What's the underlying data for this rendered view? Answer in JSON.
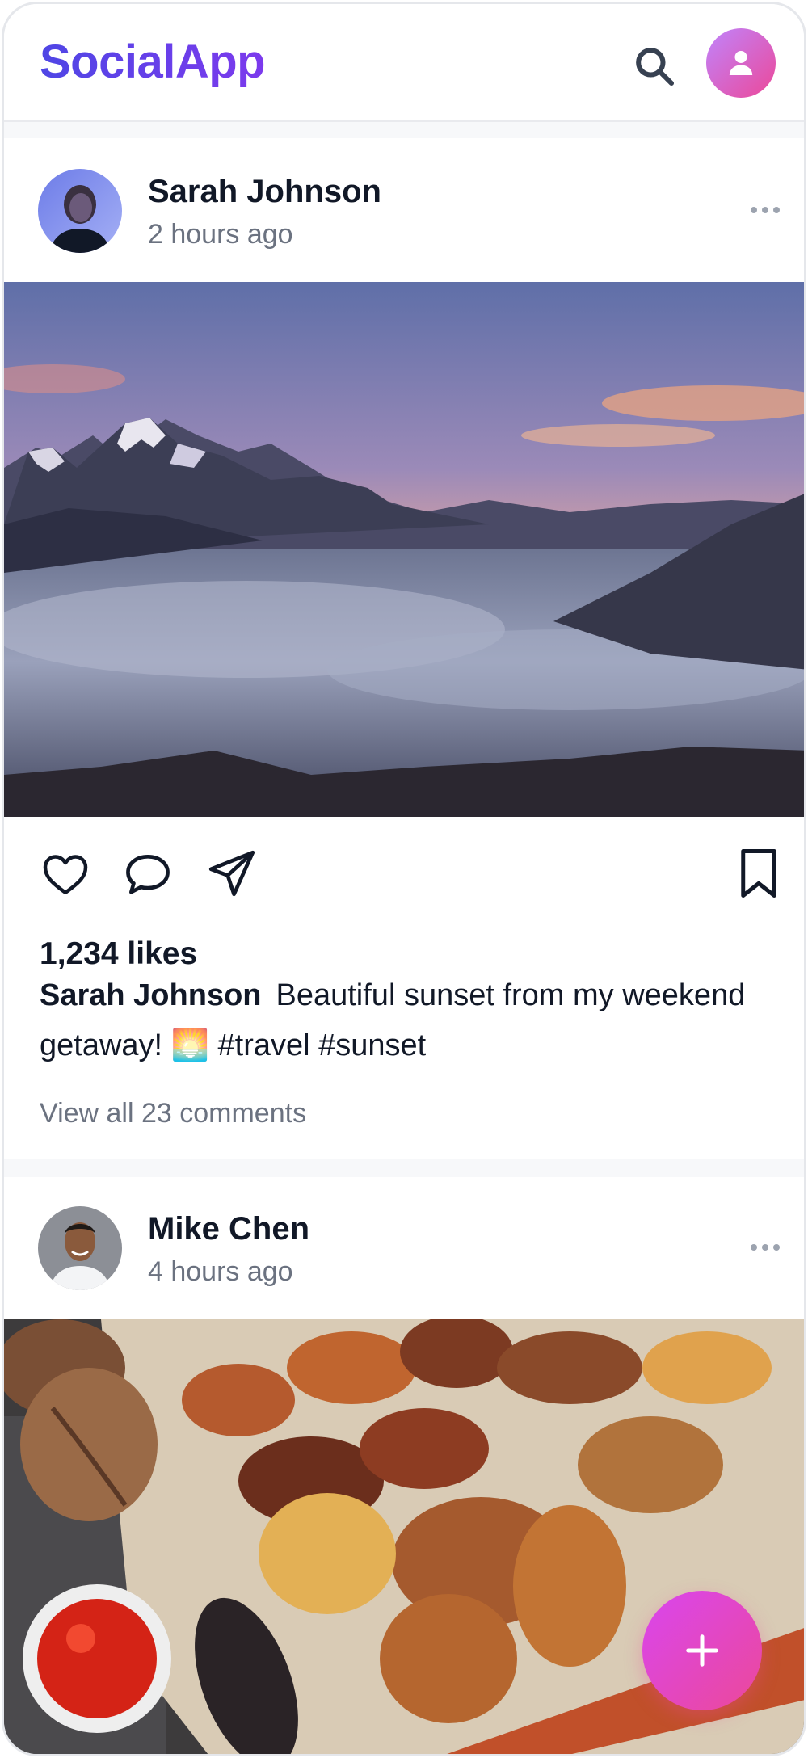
{
  "app": {
    "title": "SocialApp",
    "brand_color": "#4f46e5",
    "accent_gradient": [
      "#d946ef",
      "#ec4899"
    ]
  },
  "header": {
    "search_icon": "search-icon",
    "profile_icon": "user-icon"
  },
  "posts": [
    {
      "author": "Sarah Johnson",
      "time": "2 hours ago",
      "image": "mountain-sunset-photo",
      "likes": "1,234 likes",
      "caption_author": "Sarah Johnson",
      "caption_text": "Beautiful sunset from my weekend getaway! 🌅 #travel #sunset",
      "comments_link": "View all 23 comments"
    },
    {
      "author": "Mike Chen",
      "time": "4 hours ago",
      "image": "grilled-food-photo"
    }
  ],
  "actions": [
    "heart-icon",
    "comment-icon",
    "share-icon",
    "bookmark-icon"
  ],
  "fab": {
    "icon": "plus-icon"
  }
}
